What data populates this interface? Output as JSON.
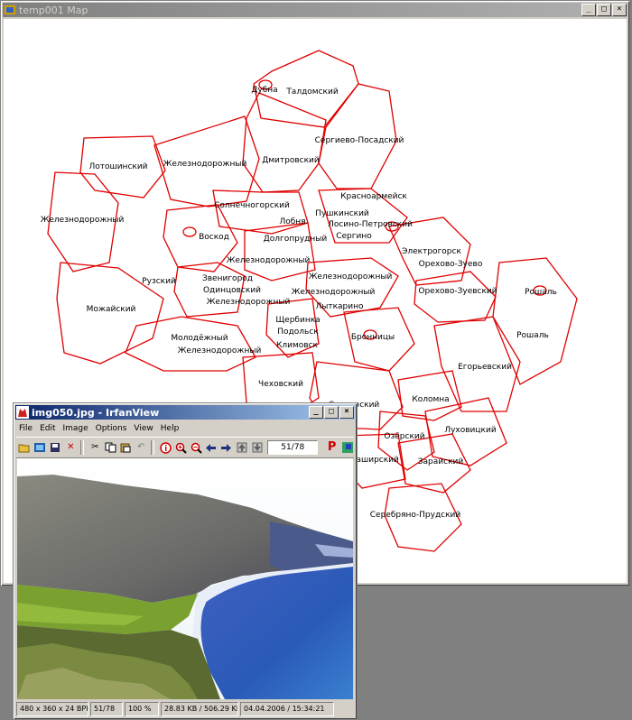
{
  "map_window": {
    "title": "temp001 Map",
    "labels": [
      "Дубна",
      "Талдомский",
      "Сергиево-Посадский",
      "Дмитровский",
      "Лотошинский",
      "Железнодорожный",
      "Железнодорожный",
      "Солнечногорский",
      "Красноармейск",
      "Пушкинский",
      "Лобня",
      "Лосино-Петровский",
      "Долгопрудный",
      "Сергино",
      "Воскод",
      "Железнодорожный",
      "Электрогорск",
      "Орехово-Зуево",
      "Звенигород",
      "Рузский",
      "Одинцовский",
      "Железнодорожный",
      "Железнодорожный",
      "Железнодорожный",
      "Орехово-Зуевский",
      "Рошаль",
      "Лыткарино",
      "Можайский",
      "Щербинка",
      "Подольск",
      "Климовск",
      "Молодёжный",
      "Железнодорожный",
      "Бронницы",
      "Рошаль",
      "Егорьевский",
      "Чеховский",
      "Ступинский",
      "Коломна",
      "Луховицкий",
      "Озёрский",
      "Каширский",
      "Зарайский",
      "Серебряно-Прудский"
    ]
  },
  "irfanview": {
    "title": "img050.jpg - IrfanView",
    "menu": [
      "File",
      "Edit",
      "Image",
      "Options",
      "View",
      "Help"
    ],
    "page_counter": "51/78",
    "status": [
      "480 x 360 x 24 BPP",
      "51/78",
      "100 %",
      "28.83 KB / 506.29 KB",
      "04.04.2006 / 15:34:21"
    ]
  },
  "colors": {
    "map_stroke": "#e00000",
    "inactive_title": "#808080",
    "active_title_start": "#0a246a",
    "active_title_end": "#a6caf0"
  }
}
